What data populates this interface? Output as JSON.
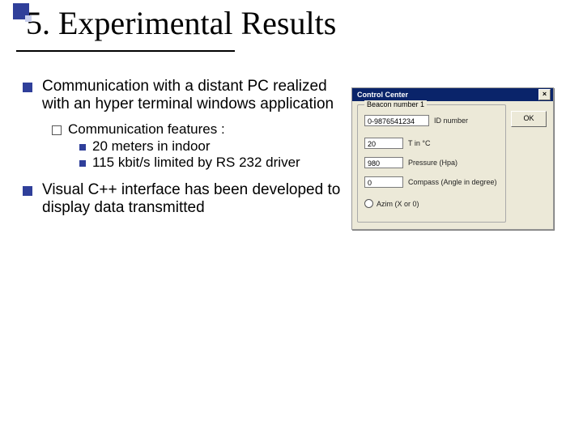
{
  "title": "5. Experimental Results",
  "bullets": {
    "b1": "Communication with a distant PC realized with an hyper terminal windows application",
    "b1_sub": "Communication features :",
    "b1_s1": "20 meters in indoor",
    "b1_s2": "115 kbit/s limited by RS 232 driver",
    "b2": "Visual C++ interface has been developed to display data transmitted"
  },
  "dialog": {
    "title": "Control Center",
    "close": "×",
    "ok": "OK",
    "group_legend": "Beacon number 1",
    "id_value": "0-9876541234",
    "id_label": "ID number",
    "temp_value": "20",
    "temp_label": "T in °C",
    "pressure_value": "980",
    "pressure_label": "Pressure (Hpa)",
    "compass_value": "0",
    "compass_label": "Compass (Angle in degree)",
    "azim_label": "Azim (X or 0)"
  }
}
